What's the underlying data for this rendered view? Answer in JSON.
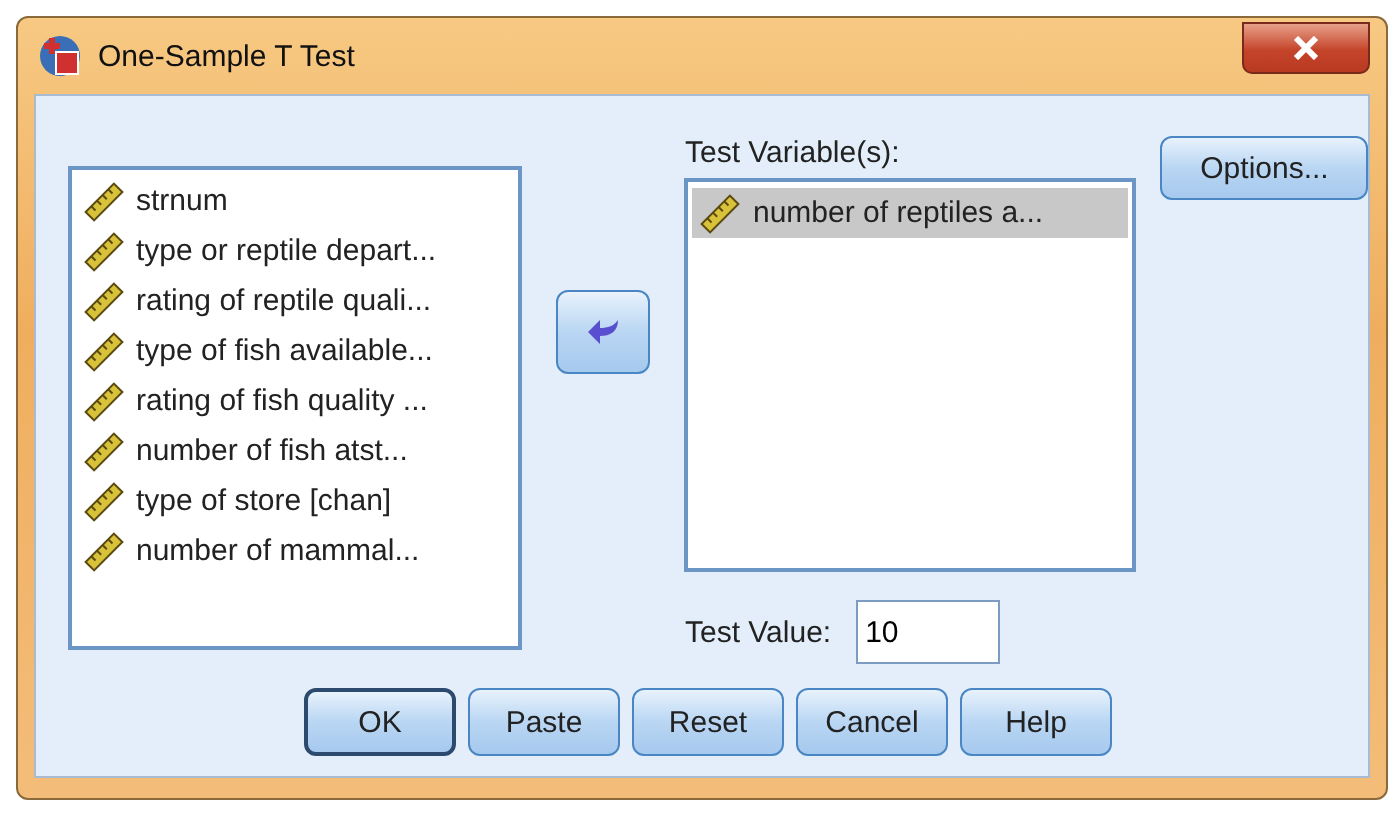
{
  "window": {
    "title": "One-Sample T Test"
  },
  "source_list": {
    "items": [
      {
        "label": "strnum",
        "selected": false
      },
      {
        "label": "type or reptile depart...",
        "selected": false
      },
      {
        "label": "rating of reptile quali...",
        "selected": false
      },
      {
        "label": "type of fish available...",
        "selected": false
      },
      {
        "label": "rating of fish quality ...",
        "selected": false
      },
      {
        "label": "number of fish atst...",
        "selected": false
      },
      {
        "label": "type of store [chan]",
        "selected": false
      },
      {
        "label": "number of mammal...",
        "selected": false
      }
    ]
  },
  "test_variables": {
    "label": "Test Variable(s):",
    "items": [
      {
        "label": "number of reptiles a...",
        "selected": true
      }
    ]
  },
  "options_button": "Options...",
  "test_value": {
    "label": "Test Value:",
    "value": "10"
  },
  "buttons": [
    {
      "label": "OK",
      "default": true
    },
    {
      "label": "Paste",
      "default": false
    },
    {
      "label": "Reset",
      "default": false
    },
    {
      "label": "Cancel",
      "default": false
    },
    {
      "label": "Help",
      "default": false
    }
  ]
}
